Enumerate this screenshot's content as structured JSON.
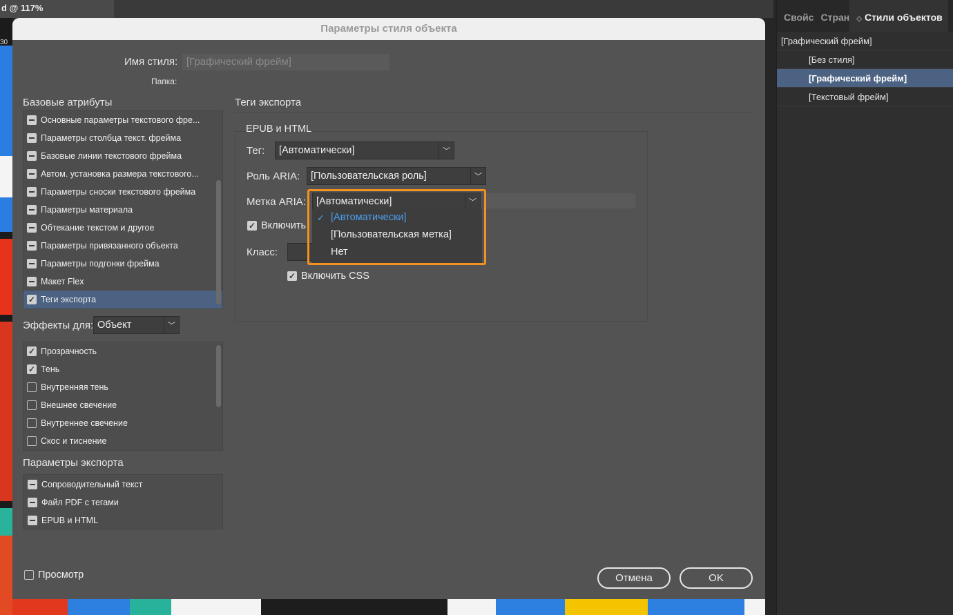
{
  "app": {
    "doc_tab": "d @ 117%",
    "zoom_fragment": "30"
  },
  "panel": {
    "tabs": [
      "Свойс",
      "Стран",
      "Стили объектов"
    ],
    "items": [
      {
        "label": "[Графический фрейм]",
        "level": "root"
      },
      {
        "label": "[Без стиля]",
        "level": "child"
      },
      {
        "label": "[Графический фрейм]",
        "level": "child",
        "selected": true
      },
      {
        "label": "[Текстовый фрейм]",
        "level": "child"
      }
    ]
  },
  "dialog": {
    "title": "Параметры стиля объекта",
    "style_name_label": "Имя стиля:",
    "style_name_value": "[Графический фрейм]",
    "folder_label": "Папка:",
    "base_attrs_title": "Базовые атрибуты",
    "base_attrs": [
      "Основные параметры текстового фре...",
      "Параметры столбца текст. фрейма",
      "Базовые линии текстового фрейма",
      "Автом. установка размера текстового...",
      "Параметры сноски текстового фрейма",
      "Параметры материала",
      "Обтекание текстом и другое",
      "Параметры привязанного объекта",
      "Параметры подгонки фрейма",
      "Макет Flex",
      "Теги экспорта"
    ],
    "effects_label": "Эффекты для:",
    "effects_value": "Объект",
    "effects": [
      {
        "label": "Прозрачность",
        "checked": true
      },
      {
        "label": "Тень",
        "checked": true
      },
      {
        "label": "Внутренняя тень",
        "checked": false
      },
      {
        "label": "Внешнее свечение",
        "checked": false
      },
      {
        "label": "Внутреннее свечение",
        "checked": false
      },
      {
        "label": "Скос и тиснение",
        "checked": false
      }
    ],
    "export_params_title": "Параметры экспорта",
    "export_params": [
      "Сопроводительный текст",
      "Файл PDF с тегами",
      "EPUB и HTML"
    ],
    "preview_label": "Просмотр",
    "cancel_label": "Отмена",
    "ok_label": "OK"
  },
  "export_tags": {
    "title": "Теги экспорта",
    "group_title": "EPUB и HTML",
    "tag_label": "Тег:",
    "tag_value": "[Автоматически]",
    "aria_role_label": "Роль ARIA:",
    "aria_role_value": "[Пользовательская роль]",
    "aria_label_label": "Метка ARIA:",
    "aria_label_value": "[Автоматически]",
    "include_label": "Включить",
    "class_label": "Класс:",
    "include_css_label": "Включить CSS",
    "dropdown_options": [
      "[Автоматически]",
      "[Пользовательская метка]",
      "Нет"
    ],
    "dropdown_selected": "[Автоматически]"
  },
  "colors": {
    "accent": "#f5911e",
    "selection": "#4b6282",
    "link": "#4c9ff0"
  }
}
